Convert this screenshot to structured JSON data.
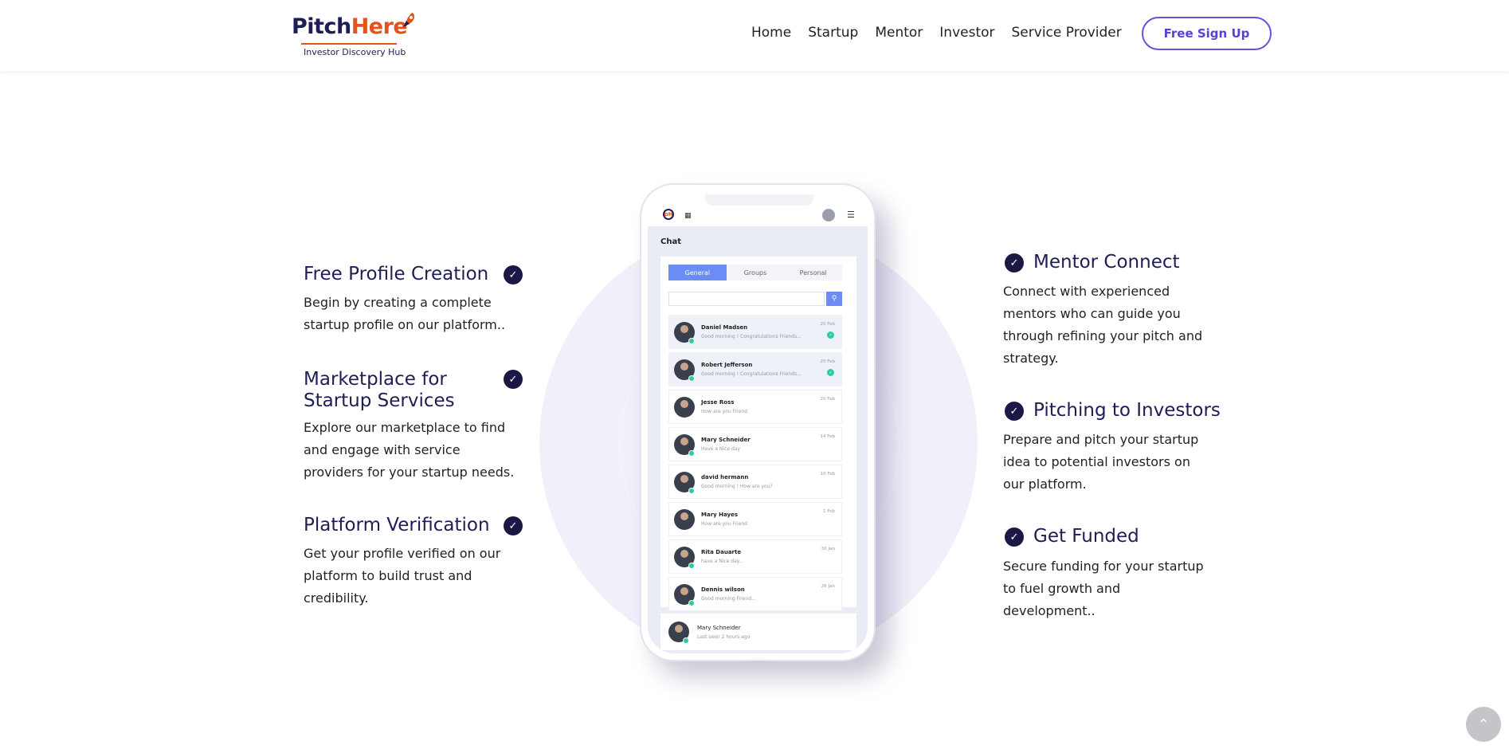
{
  "brand": {
    "name_part1": "Pitch",
    "name_part2": "Here",
    "tagline": "Investor Discovery Hub",
    "colors": {
      "navy": "#1f1d55",
      "orange": "#e8501e",
      "accent": "#6a4fe0"
    }
  },
  "nav": {
    "items": [
      "Home",
      "Startup",
      "Mentor",
      "Investor",
      "Service Provider"
    ],
    "signup_label": "Free Sign Up"
  },
  "features_left": [
    {
      "title": "Free Profile Creation",
      "text": "Begin by creating a complete startup profile on our platform.."
    },
    {
      "title": "Marketplace for Startup Services",
      "text": "Explore our marketplace to find and engage with service providers for your startup needs."
    },
    {
      "title": "Platform Verification",
      "text": "Get your profile verified on our platform to build trust and credibility."
    }
  ],
  "features_right": [
    {
      "title": "Mentor Connect",
      "text": "Connect with experienced mentors who can guide you through refining your pitch and strategy."
    },
    {
      "title": "Pitching to Investors",
      "text": "Prepare and pitch your startup idea to potential investors on our platform."
    },
    {
      "title": "Get Funded",
      "text": "Secure funding for your startup to fuel growth and development.."
    }
  ],
  "check_icon": "check-circle-icon",
  "phone": {
    "logo_text": "pH",
    "chat_title": "Chat",
    "tabs": [
      "General",
      "Groups",
      "Personal"
    ],
    "active_tab": "General",
    "search_icon": "search-icon",
    "contacts": [
      {
        "name": "Daniel Madsen",
        "message": "Good  morning ! Congratulations Friends...",
        "date": "20 Feb",
        "unread": ""
      },
      {
        "name": "Robert Jefferson",
        "message": "Good  morning ! Congratulations Friends...",
        "date": "20 Feb",
        "unread": ""
      },
      {
        "name": "Jesse Ross",
        "message": "How are you Friend",
        "date": "20 Feb"
      },
      {
        "name": "Mary Schneider",
        "message": "Have a Nice day",
        "date": "14 Feb"
      },
      {
        "name": "david hermann",
        "message": "Good  morning !  How are you?",
        "date": "10 Feb"
      },
      {
        "name": "Mary Hayes",
        "message": "How are you Friend",
        "date": "1 Feb"
      },
      {
        "name": "Rita Dauarte",
        "message": "have a Nice day..",
        "date": "30 Jan"
      },
      {
        "name": "Dennis wilson",
        "message": "Good  morning Friend...",
        "date": "26 Jan"
      }
    ],
    "footer_user": {
      "name": "Mary Schneider",
      "status": "Last seen 2 hours ago"
    }
  },
  "scroll_top_icon": "chevron-up-icon"
}
